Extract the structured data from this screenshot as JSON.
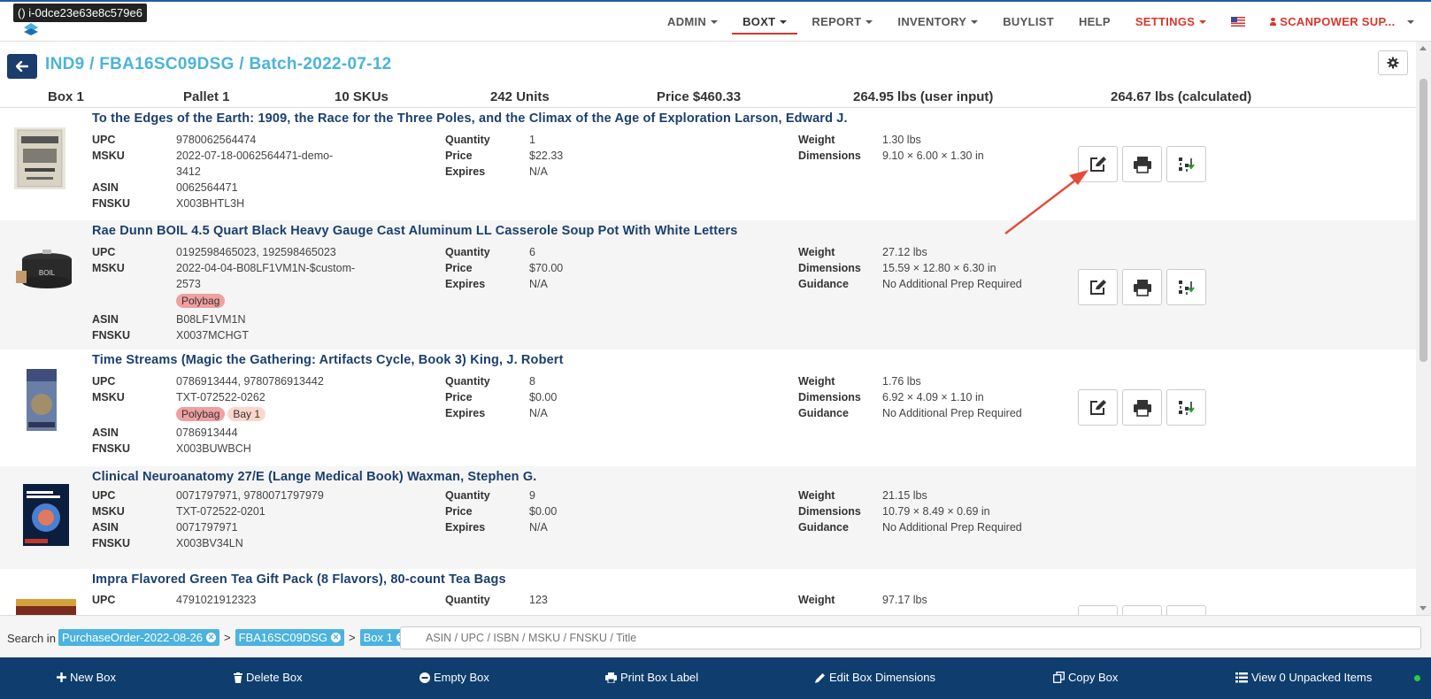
{
  "instance_tag": "() i-0dce23e63e8c579e6",
  "nav": {
    "items": [
      {
        "label": "ADMIN",
        "dropdown": true
      },
      {
        "label": "BOXT",
        "dropdown": true,
        "active": true
      },
      {
        "label": "REPORT",
        "dropdown": true
      },
      {
        "label": "INVENTORY",
        "dropdown": true
      },
      {
        "label": "BUYLIST",
        "dropdown": false
      },
      {
        "label": "HELP",
        "dropdown": false
      },
      {
        "label": "SETTINGS",
        "dropdown": true,
        "color": "#d9362b"
      }
    ],
    "user": "SCANPOWER SUP..."
  },
  "page": {
    "title": "IND9 / FBA16SC09DSG / Batch-2022-07-12"
  },
  "summary": {
    "box": "Box 1",
    "pallet": "Pallet 1",
    "skus": "10 SKUs",
    "units": "242 Units",
    "price": "Price $460.33",
    "weight_user": "264.95 lbs (user input)",
    "weight_calc": "264.67 lbs (calculated)"
  },
  "labels": {
    "upc": "UPC",
    "msku": "MSKU",
    "asin": "ASIN",
    "fnsku": "FNSKU",
    "quantity": "Quantity",
    "price": "Price",
    "expires": "Expires",
    "weight": "Weight",
    "dimensions": "Dimensions",
    "guidance": "Guidance"
  },
  "items": [
    {
      "title": "To the Edges of the Earth: 1909, the Race for the Three Poles, and the Climax of the Age of Exploration Larson, Edward J.",
      "upc": "9780062564474",
      "msku_line1": "2022-07-18-0062564471-demo-",
      "msku_line2": "3412",
      "asin": "0062564471",
      "fnsku": "X003BHTL3H",
      "quantity": "1",
      "price": "$22.33",
      "expires": "N/A",
      "weight": "1.30 lbs",
      "dimensions": "9.10 × 6.00 × 1.30 in"
    },
    {
      "title": "Rae Dunn BOIL 4.5 Quart Black Heavy Gauge Cast Aluminum LL Casserole Soup Pot With White Letters",
      "upc": "0192598465023, 192598465023",
      "msku_line1": "2022-04-04-B08LF1VM1N-$custom-",
      "msku_line2": "2573",
      "badges": [
        "Polybag"
      ],
      "asin": "B08LF1VM1N",
      "fnsku": "X0037MCHGT",
      "quantity": "6",
      "price": "$70.00",
      "expires": "N/A",
      "weight": "27.12 lbs",
      "dimensions": "15.59 × 12.80 × 6.30 in",
      "guidance": "No Additional Prep Required"
    },
    {
      "title": "Time Streams (Magic the Gathering: Artifacts Cycle, Book 3) King, J. Robert",
      "upc": "0786913444, 9780786913442",
      "msku": "TXT-072522-0262",
      "badges": [
        "Polybag",
        "Bay 1"
      ],
      "asin": "0786913444",
      "fnsku": "X003BUWBCH",
      "quantity": "8",
      "price": "$0.00",
      "expires": "N/A",
      "weight": "1.76 lbs",
      "dimensions": "6.92 × 4.09 × 1.10 in",
      "guidance": "No Additional Prep Required"
    },
    {
      "title": "Clinical Neuroanatomy 27/E (Lange Medical Book) Waxman, Stephen G.",
      "upc": "0071797971, 9780071797979",
      "msku": "TXT-072522-0201",
      "asin": "0071797971",
      "fnsku": "X003BV34LN",
      "quantity": "9",
      "price": "$0.00",
      "expires": "N/A",
      "weight": "21.15 lbs",
      "dimensions": "10.79 × 8.49 × 0.69 in",
      "guidance": "No Additional Prep Required"
    },
    {
      "title": "Impra Flavored Green Tea Gift Pack (8 Flavors), 80-count Tea Bags",
      "upc": "4791021912323",
      "quantity": "123",
      "weight": "97.17 lbs"
    }
  ],
  "search": {
    "label": "Search in",
    "crumbs": [
      "PurchaseOrder-2022-08-26",
      "FBA16SC09DSG",
      "Box 1"
    ],
    "placeholder": "ASIN / UPC / ISBN / MSKU / FNSKU / Title"
  },
  "bottom_bar": {
    "new_box": "New Box",
    "delete_box": "Delete Box",
    "empty_box": "Empty Box",
    "print_box_label": "Print Box Label",
    "edit_box_dimensions": "Edit Box Dimensions",
    "copy_box": "Copy Box",
    "view_unpacked": "View 0 Unpacked Items"
  },
  "colors": {
    "brand_dark": "#0e3d6e",
    "title_blue": "#4bb3dd",
    "item_title": "#1b3f6e",
    "accent_red": "#d9362b",
    "badge_polybag": "#f0a0a0",
    "badge_bay": "#fbd6cc",
    "annotation_arrow": "#e34b3a"
  },
  "icons": {
    "row_actions": [
      "edit-icon",
      "print-icon",
      "split-icon"
    ]
  }
}
